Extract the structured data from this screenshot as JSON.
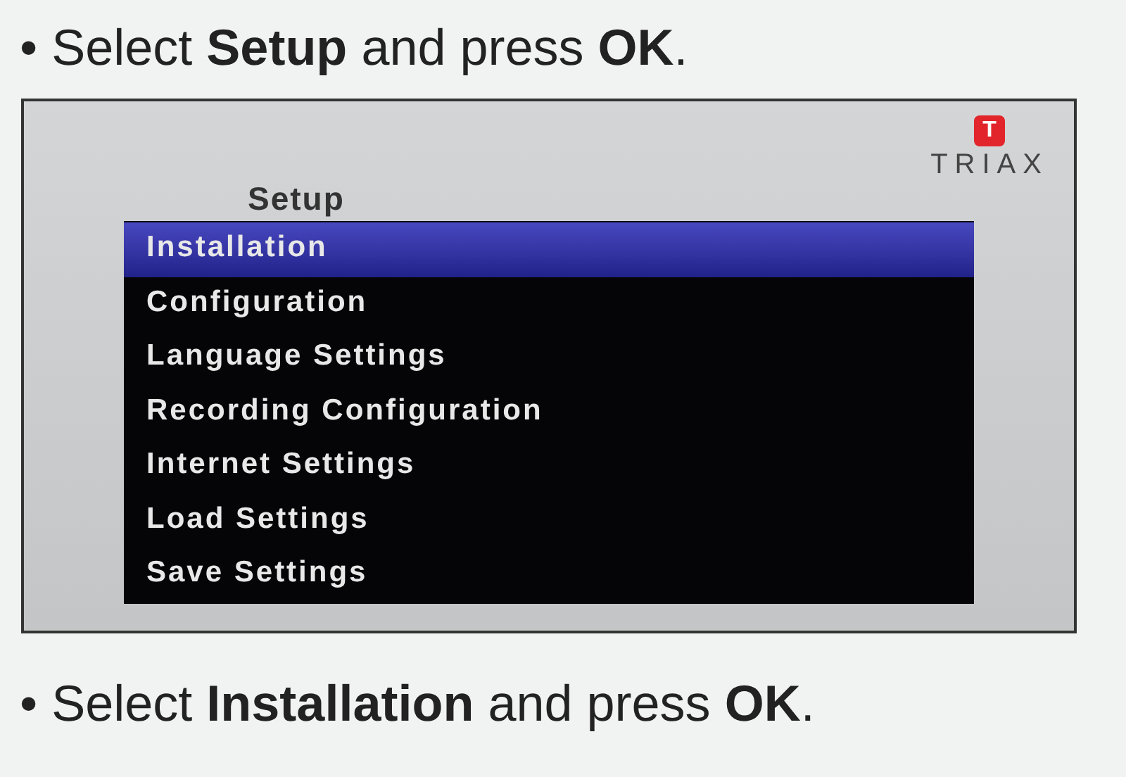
{
  "instructions": [
    {
      "text": "• Select **Setup** and press **OK**."
    },
    {
      "text": "• Select **Installation** and press **OK**."
    }
  ],
  "screen": {
    "title": "Setup",
    "logo": {
      "mark": "T",
      "name": "TRIAX"
    },
    "menu": [
      {
        "label": "Installation",
        "selected": true
      },
      {
        "label": "Configuration",
        "selected": false
      },
      {
        "label": "Language Settings",
        "selected": false
      },
      {
        "label": "Recording Configuration",
        "selected": false
      },
      {
        "label": "Internet Settings",
        "selected": false
      },
      {
        "label": "Load Settings",
        "selected": false
      },
      {
        "label": "Save Settings",
        "selected": false
      }
    ]
  }
}
